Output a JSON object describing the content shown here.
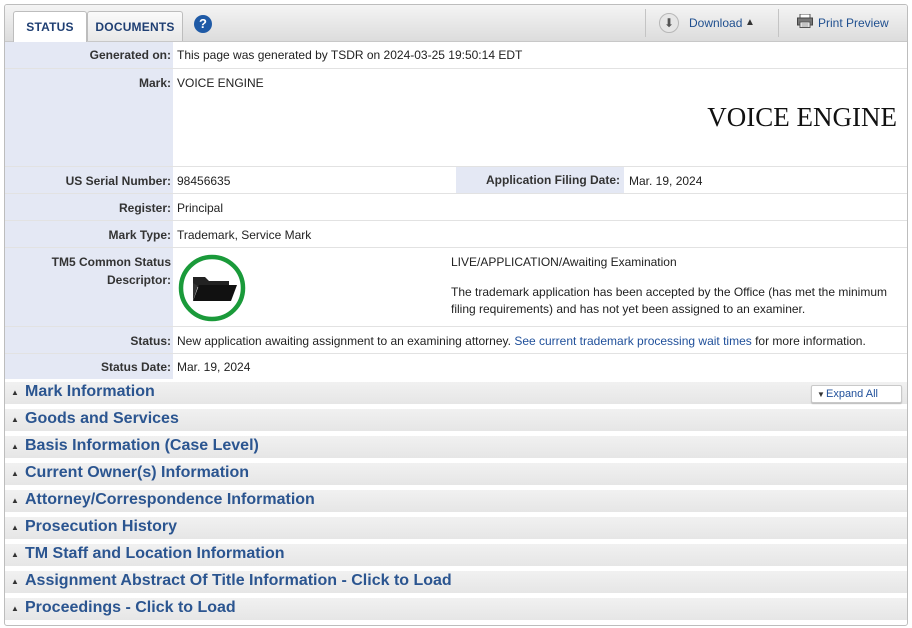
{
  "tabs": {
    "status": "STATUS",
    "documents": "DOCUMENTS",
    "help": "?"
  },
  "toolbar": {
    "download": "Download",
    "download_caret": "▲",
    "print_preview": "Print Preview"
  },
  "fields": {
    "generated_label": "Generated on:",
    "generated_value": "This page was generated by TSDR on 2024-03-25 19:50:14 EDT",
    "mark_label": "Mark:",
    "mark_value": "VOICE ENGINE",
    "mark_image_text": "VOICE ENGINE",
    "serial_label": "US Serial Number:",
    "serial_value": "98456635",
    "filing_label": "Application Filing Date:",
    "filing_value": "Mar. 19, 2024",
    "register_label": "Register:",
    "register_value": "Principal",
    "marktype_label": "Mark Type:",
    "marktype_value": "Trademark, Service Mark",
    "tm5_label_1": "TM5 Common Status",
    "tm5_label_2": "Descriptor:",
    "tm5_status": "LIVE/APPLICATION/Awaiting Examination",
    "tm5_desc_1": "The trademark application has been accepted by the Office (has met the minimum",
    "tm5_desc_2": "filing requirements) and has not yet been assigned to an examiner.",
    "status_label": "Status:",
    "status_text_pre": "New application awaiting assignment to an examining attorney.",
    "status_link": "See current trademark processing wait times",
    "status_text_post": "for more information.",
    "status_date_label": "Status Date:",
    "status_date_value": "Mar. 19, 2024"
  },
  "expand_all": "Expand All",
  "sections": [
    "Mark Information",
    "Goods and Services",
    "Basis Information (Case Level)",
    "Current Owner(s) Information",
    "Attorney/Correspondence Information",
    "Prosecution History",
    "TM Staff and Location Information",
    "Assignment Abstract Of Title Information - Click to Load",
    "Proceedings - Click to Load"
  ],
  "colors": {
    "label_bg": "#e4e8f4",
    "link": "#1f4f9a",
    "status_ring": "#1a9a3a"
  },
  "icons": {
    "help": "help-icon",
    "download": "download-icon",
    "print": "printer-icon",
    "status": "folder-icon"
  }
}
